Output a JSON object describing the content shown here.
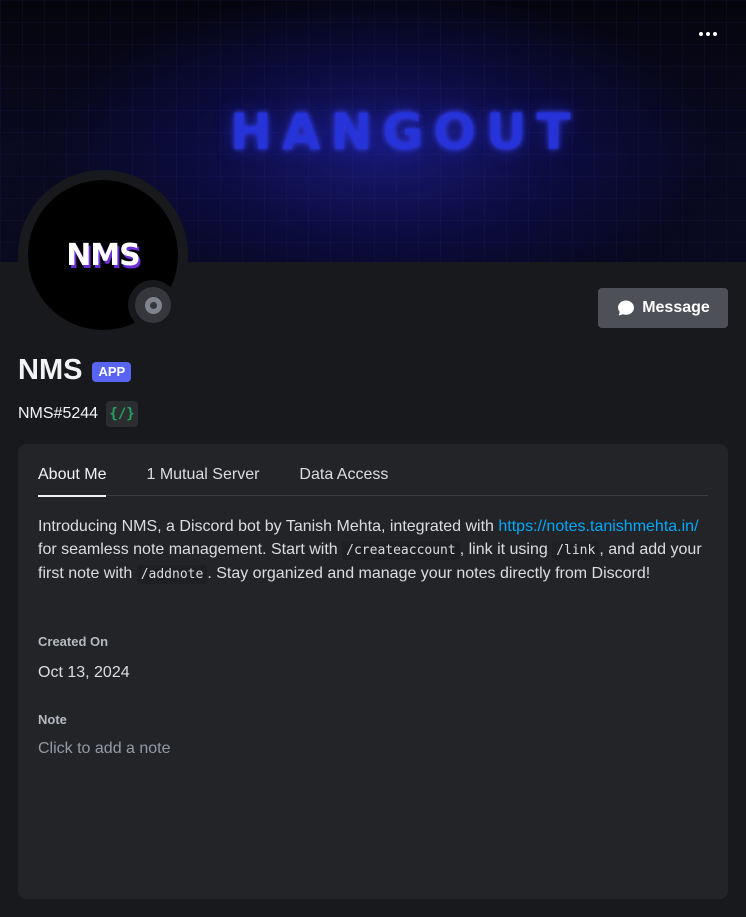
{
  "banner": {
    "logo_text": "HANGOUT",
    "more_icon": "ellipsis-icon"
  },
  "avatar": {
    "text": "NMS",
    "status": "offline"
  },
  "actions": {
    "message_label": "Message",
    "message_icon": "chat-bubble-icon"
  },
  "profile": {
    "display_name": "NMS",
    "badge": "APP",
    "username": "NMS#5244",
    "slash_badge": "{/}"
  },
  "tabs": [
    {
      "label": "About Me",
      "active": true
    },
    {
      "label": "1 Mutual Server",
      "active": false
    },
    {
      "label": "Data Access",
      "active": false
    }
  ],
  "about": {
    "part1": "Introducing NMS, a Discord bot by Tanish Mehta, integrated with ",
    "link": "https://notes.tanishmehta.in/",
    "part2": " for seamless note management. Start with ",
    "code1": "/createaccount",
    "part3": ", link it using ",
    "code2": "/link",
    "part4": ", and add your first note with ",
    "code3": "/addnote",
    "part5": ". Stay organized and manage your notes directly from Discord!"
  },
  "created": {
    "label": "Created On",
    "value": "Oct 13, 2024"
  },
  "note": {
    "label": "Note",
    "placeholder": "Click to add a note"
  },
  "colors": {
    "background": "#18191c",
    "card": "#232428",
    "accent": "#5865f2",
    "link": "#00a8fc",
    "slash_green": "#23a55a"
  }
}
